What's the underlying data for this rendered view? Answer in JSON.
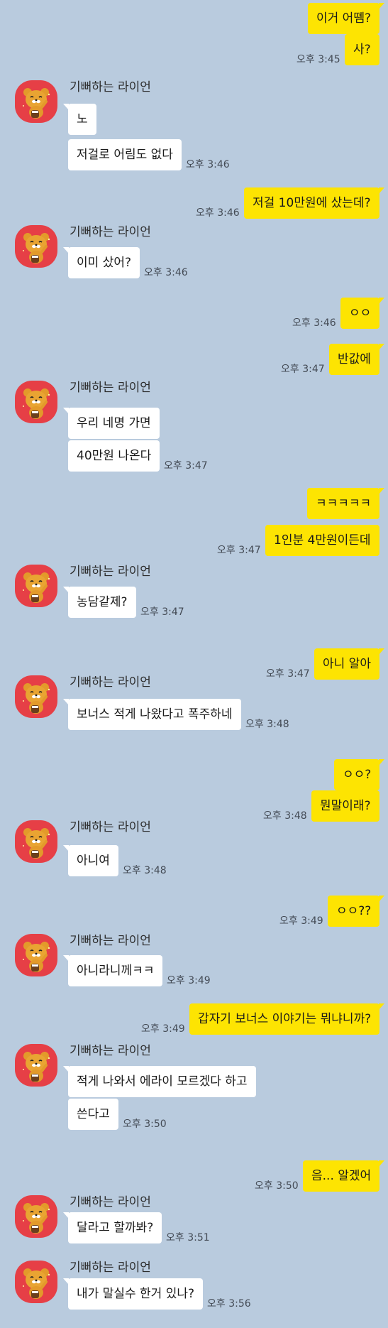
{
  "contact": {
    "name": "기뻐하는 라이언",
    "avatar_icon": "ryan-character-icon",
    "avatar_bg": "#e63f46"
  },
  "colors": {
    "background": "#b9cbde",
    "my_bubble": "#fde402",
    "their_bubble": "#ffffff"
  },
  "messages": [
    {
      "text": "이거 어뗌?",
      "me": true
    },
    {
      "text": "사?",
      "me": true,
      "time": "오후 3:45"
    },
    {
      "text": "노",
      "me": false
    },
    {
      "text": "저걸로 어림도 없다",
      "me": false,
      "time": "오후 3:46"
    },
    {
      "text": "저걸 10만원에 샀는데?",
      "me": true,
      "time": "오후 3:46"
    },
    {
      "text": "이미 샀어?",
      "me": false,
      "time": "오후 3:46"
    },
    {
      "text": "ㅇㅇ",
      "me": true,
      "time": "오후 3:46"
    },
    {
      "text": "반값에",
      "me": true,
      "time": "오후 3:47"
    },
    {
      "text": "우리 네명 가면",
      "me": false
    },
    {
      "text": "40만원 나온다",
      "me": false,
      "time": "오후 3:47"
    },
    {
      "text": "ㅋㅋㅋㅋㅋ",
      "me": true
    },
    {
      "text": "1인분 4만원이든데",
      "me": true,
      "time": "오후 3:47"
    },
    {
      "text": "농담같제?",
      "me": false,
      "time": "오후 3:47"
    },
    {
      "text": "아니 알아",
      "me": true,
      "time": "오후 3:47"
    },
    {
      "text": "보너스 적게 나왔다고 폭주하네",
      "me": false,
      "time": "오후 3:48"
    },
    {
      "text": "ㅇㅇ?",
      "me": true
    },
    {
      "text": "뭔말이래?",
      "me": true,
      "time": "오후 3:48"
    },
    {
      "text": "아니여",
      "me": false,
      "time": "오후 3:48"
    },
    {
      "text": "ㅇㅇ??",
      "me": true,
      "time": "오후 3:49"
    },
    {
      "text": "아니라니께ㅋㅋ",
      "me": false,
      "time": "오후 3:49"
    },
    {
      "text": "갑자기 보너스 이야기는 뭐냐니까?",
      "me": true,
      "time": "오후 3:49"
    },
    {
      "text": "적게 나와서 에라이 모르겠다 하고",
      "me": false
    },
    {
      "text": "쓴다고",
      "me": false,
      "time": "오후 3:50"
    },
    {
      "text": "음... 알겠어",
      "me": true,
      "time": "오후 3:50"
    },
    {
      "text": "달라고 할까봐?",
      "me": false,
      "time": "오후 3:51"
    },
    {
      "text": "내가 말실수 한거 있나?",
      "me": false,
      "time": "오후 3:56"
    }
  ]
}
